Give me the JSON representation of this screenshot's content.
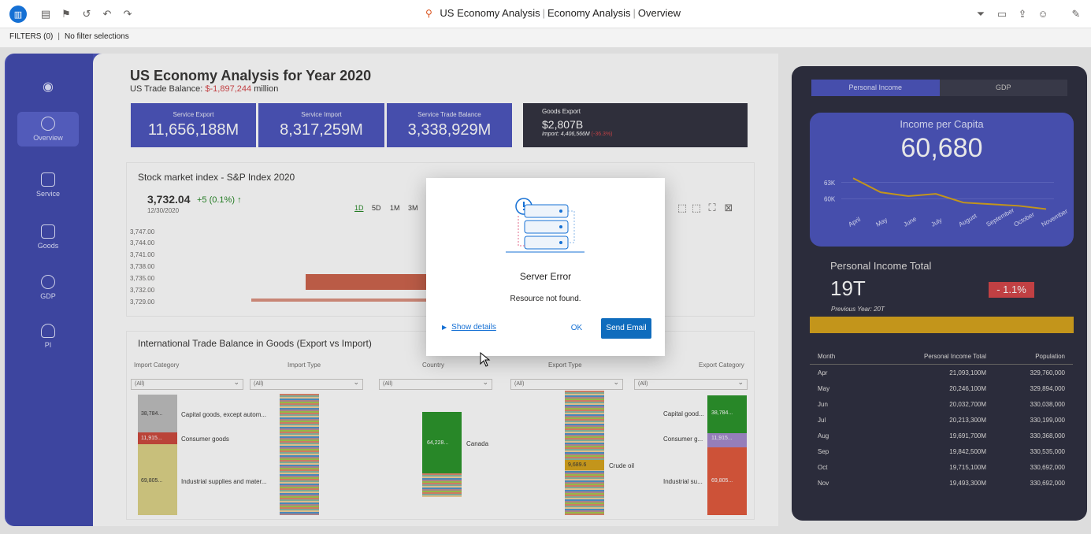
{
  "topbar": {
    "title_parts": [
      "US Economy Analysis",
      "Economy Analysis",
      "Overview"
    ]
  },
  "filters": {
    "label": "FILTERS (0)",
    "value": "No filter selections"
  },
  "sidebar": {
    "items": [
      {
        "label": "Overview"
      },
      {
        "label": "Service"
      },
      {
        "label": "Goods"
      },
      {
        "label": "GDP"
      },
      {
        "label": "PI"
      }
    ]
  },
  "main": {
    "title": "US Economy Analysis for Year 2020",
    "trade_balance_label": "US Trade Balance:",
    "trade_balance_value": "$-1,897,244",
    "trade_balance_unit": "million",
    "kpis": [
      {
        "label": "Service Export",
        "value": "11,656,188M"
      },
      {
        "label": "Service Import",
        "value": "8,317,259M"
      },
      {
        "label": "Service Trade Balance",
        "value": "3,338,929M"
      }
    ],
    "goods_export": {
      "label": "Goods Export",
      "value": "$2,807B",
      "import_label": "Import: 4,406,566M",
      "pct": "(-36.3%)"
    },
    "stock": {
      "title": "Stock market index - S&P Index 2020",
      "value": "3,732.04",
      "change": "+5 (0.1%)",
      "date": "12/30/2020",
      "ranges": [
        "1D",
        "5D",
        "1M",
        "3M"
      ],
      "y_ticks": [
        "3,747.00",
        "3,744.00",
        "3,741.00",
        "3,738.00",
        "3,735.00",
        "3,732.00",
        "3,729.00"
      ]
    },
    "trade": {
      "title": "International Trade Balance in Goods (Export vs Import)",
      "columns": [
        "Import Category",
        "Import Type",
        "Country",
        "Export Type",
        "Export Category"
      ],
      "slicer_value": "(All)",
      "import_blocks": [
        {
          "value": "38,784...",
          "label": "Capital goods, except autom..."
        },
        {
          "value": "11,915...",
          "label": "Consumer goods"
        },
        {
          "value": "69,805...",
          "label": "Industrial supplies and mater..."
        }
      ],
      "country": {
        "value": "64,228...",
        "label": "Canada"
      },
      "export_type": {
        "value": "9,689.6",
        "label": "Crude oil"
      },
      "export_blocks": [
        {
          "value": "38,784...",
          "label": "Capital good..."
        },
        {
          "value": "11,915...",
          "label": "Consumer g..."
        },
        {
          "value": "69,805...",
          "label": "Industrial su..."
        }
      ]
    }
  },
  "right": {
    "tabs": [
      "Personal Income",
      "GDP"
    ],
    "ipc_label": "Income per Capita",
    "ipc_value": "60,680",
    "ipc_y_ticks": [
      "63K",
      "60K"
    ],
    "ipc_months": [
      "April",
      "May",
      "June",
      "July",
      "August",
      "September",
      "October",
      "November"
    ],
    "pit_label": "Personal Income Total",
    "pit_value": "19T",
    "pit_badge": "- 1.1%",
    "pit_prev": "Previous Year: 20T",
    "table_headers": [
      "Month",
      "Personal Income Total",
      "Population"
    ],
    "rows": [
      [
        "Apr",
        "21,093,100M",
        "329,760,000"
      ],
      [
        "May",
        "20,246,100M",
        "329,894,000"
      ],
      [
        "Jun",
        "20,032,700M",
        "330,038,000"
      ],
      [
        "Jul",
        "20,213,300M",
        "330,199,000"
      ],
      [
        "Aug",
        "19,691,700M",
        "330,368,000"
      ],
      [
        "Sep",
        "19,842,500M",
        "330,535,000"
      ],
      [
        "Oct",
        "19,715,100M",
        "330,692,000"
      ],
      [
        "Nov",
        "19,493,300M",
        "330,692,000"
      ]
    ]
  },
  "dialog": {
    "title": "Server Error",
    "message": "Resource not found.",
    "details": "Show details",
    "ok": "OK",
    "send": "Send Email"
  },
  "chart_data": {
    "type": "line",
    "title": "Income per Capita",
    "categories": [
      "April",
      "May",
      "June",
      "July",
      "August",
      "September",
      "October",
      "November"
    ],
    "values": [
      63800,
      61200,
      60500,
      60900,
      59300,
      59000,
      58700,
      58100
    ],
    "ylim": [
      57000,
      65000
    ],
    "y_ticks": [
      "63K",
      "60K"
    ]
  }
}
